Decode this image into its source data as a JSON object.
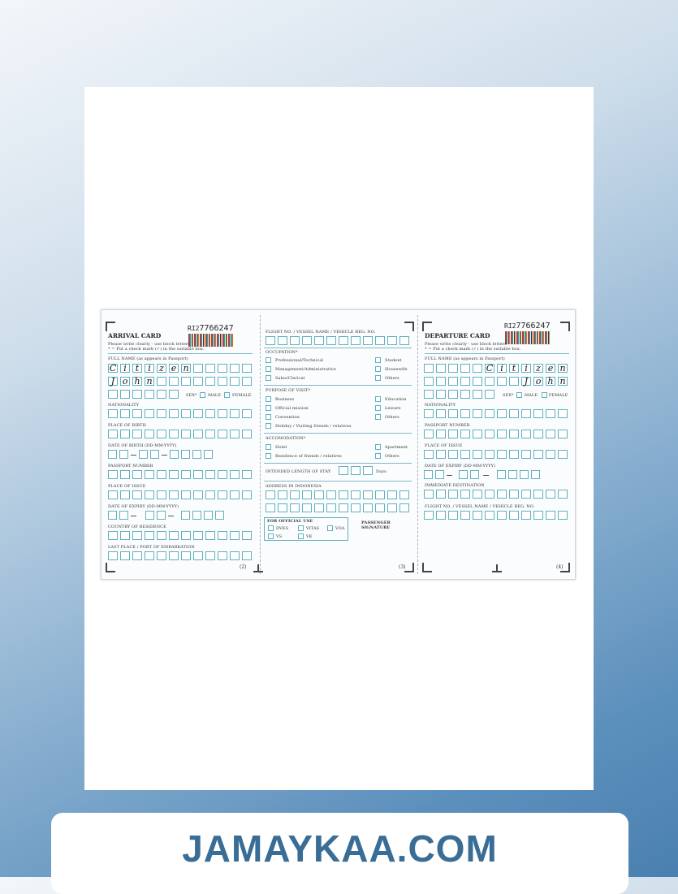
{
  "arrival": {
    "title": "ARRIVAL CARD",
    "instruction1": "Please write clearly - use block letters",
    "instruction2": "* = Put a check mark (✓) in the suitable box.",
    "serial_prefix": "RI2",
    "serial": "7766247",
    "full_name_label": "FULL NAME (as appears in Passport)",
    "surname_letters": [
      "C",
      "i",
      "t",
      "i",
      "z",
      "e",
      "n"
    ],
    "given_letters": [
      "J",
      "o",
      "h",
      "n"
    ],
    "sex_label": "SEX*",
    "male_label": "MALE",
    "female_label": "FEMALE",
    "nationality_label": "NATIONALITY",
    "place_of_birth_label": "PLACE OF BIRTH",
    "dob_label": "DATE OF BIRTH (DD-MM-YYYY)",
    "passport_number_label": "PASSPORT NUMBER",
    "place_of_issue_label": "PLACE OF ISSUE",
    "date_of_expiry_label": "DATE OF EXPIRY (DD-MM-YYYY)",
    "country_residence_label": "COUNTRY OF RESIDENCE",
    "last_place_label": "LAST PLACE / PORT OF EMBARKATION",
    "page_no": "(2)"
  },
  "middle": {
    "flight_label": "FLIGHT NO. / VESSEL NAME / VEHICLE REG. NO.",
    "occupation_label": "OCCUPATION*",
    "occupations_left": [
      "Professional/Technical",
      "Management/Administrative",
      "Sales/Clerical"
    ],
    "occupations_right": [
      "Student",
      "Housewife",
      "Others"
    ],
    "purpose_label": "PURPOSE OF VISIT*",
    "purposes_left": [
      "Business",
      "Official mission",
      "Convention",
      "Holiday / Visiting friends / relatives"
    ],
    "purposes_right": [
      "Education",
      "Leisure",
      "Others"
    ],
    "accommodation_label": "ACCOMODATION*",
    "accommodation_left": [
      "Hotel",
      "Residence of friends / relatives"
    ],
    "accommodation_right": [
      "Apartment",
      "Others"
    ],
    "stay_label": "INTENDED LENGTH OF STAY",
    "days_label": "Days",
    "address_label": "ADDRESS IN INDONESIA",
    "official_label": "FOR OFFICIAL USE",
    "official_items": [
      "DVKS",
      "VITAS",
      "VOA",
      "VS",
      "VK"
    ],
    "signature_label": "PASSENGER SIGNATURE",
    "page_no": "(3)"
  },
  "departure": {
    "title": "DEPARTURE CARD",
    "instruction1": "Please write clearly - use block letters",
    "instruction2": "* = Put a check mark (✓) in the suitable box.",
    "serial_prefix": "RI2",
    "serial": "7766247",
    "full_name_label": "FULL NAME (as appears in Passport)",
    "surname_letters": [
      "C",
      "i",
      "t",
      "i",
      "z",
      "e",
      "n"
    ],
    "given_letters": [
      "J",
      "o",
      "h",
      "n"
    ],
    "sex_label": "SEX*",
    "male_label": "MALE",
    "female_label": "FEMALE",
    "nationality_label": "NATIONALITY",
    "passport_number_label": "PASSPORT NUMBER",
    "place_of_issue_label": "PLACE OF ISSUE",
    "date_of_expiry_label": "DATE OF EXPIRY (DD-MM-YYYY)",
    "destination_label": "IMMEDIATE DESTINATION",
    "flight_label": "FLIGHT NO. / VESSEL NAME / VEHICLE REG. NO.",
    "page_no": "(4)"
  },
  "footer": {
    "brand": "JAMAYKAA.COM"
  },
  "colors": {
    "box_border": "#5fb0bf",
    "brand": "#3a6d95"
  }
}
